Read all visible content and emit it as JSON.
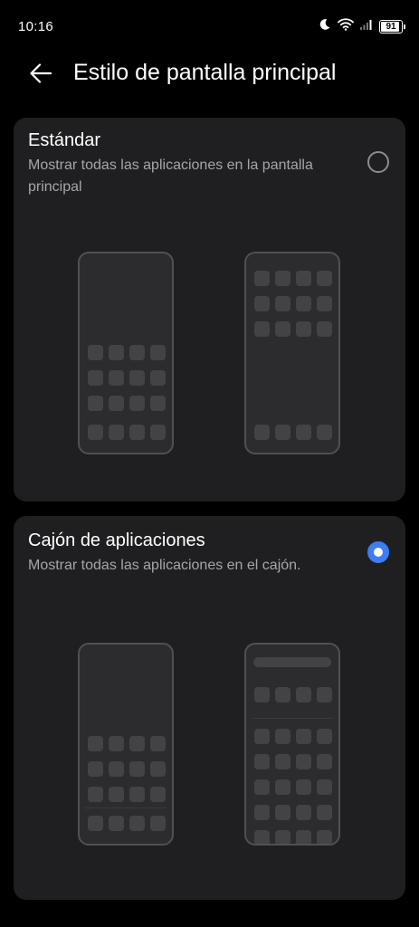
{
  "status_bar": {
    "time": "10:16",
    "battery_level": "91",
    "icons": [
      "moon-icon",
      "wifi-icon",
      "signal-icon",
      "battery-icon"
    ]
  },
  "header": {
    "back_icon": "arrow-left-icon",
    "title": "Estilo de pantalla principal"
  },
  "options": [
    {
      "title": "Estándar",
      "description": "Mostrar todas las aplicaciones en la pantalla principal",
      "selected": false
    },
    {
      "title": "Cajón de aplicaciones",
      "description": "Mostrar todas las aplicaciones en el cajón.",
      "selected": true
    }
  ],
  "colors": {
    "background": "#000000",
    "card": "#1f1f21",
    "accent": "#3d7df5",
    "secondary_text": "#a6a6a8"
  }
}
